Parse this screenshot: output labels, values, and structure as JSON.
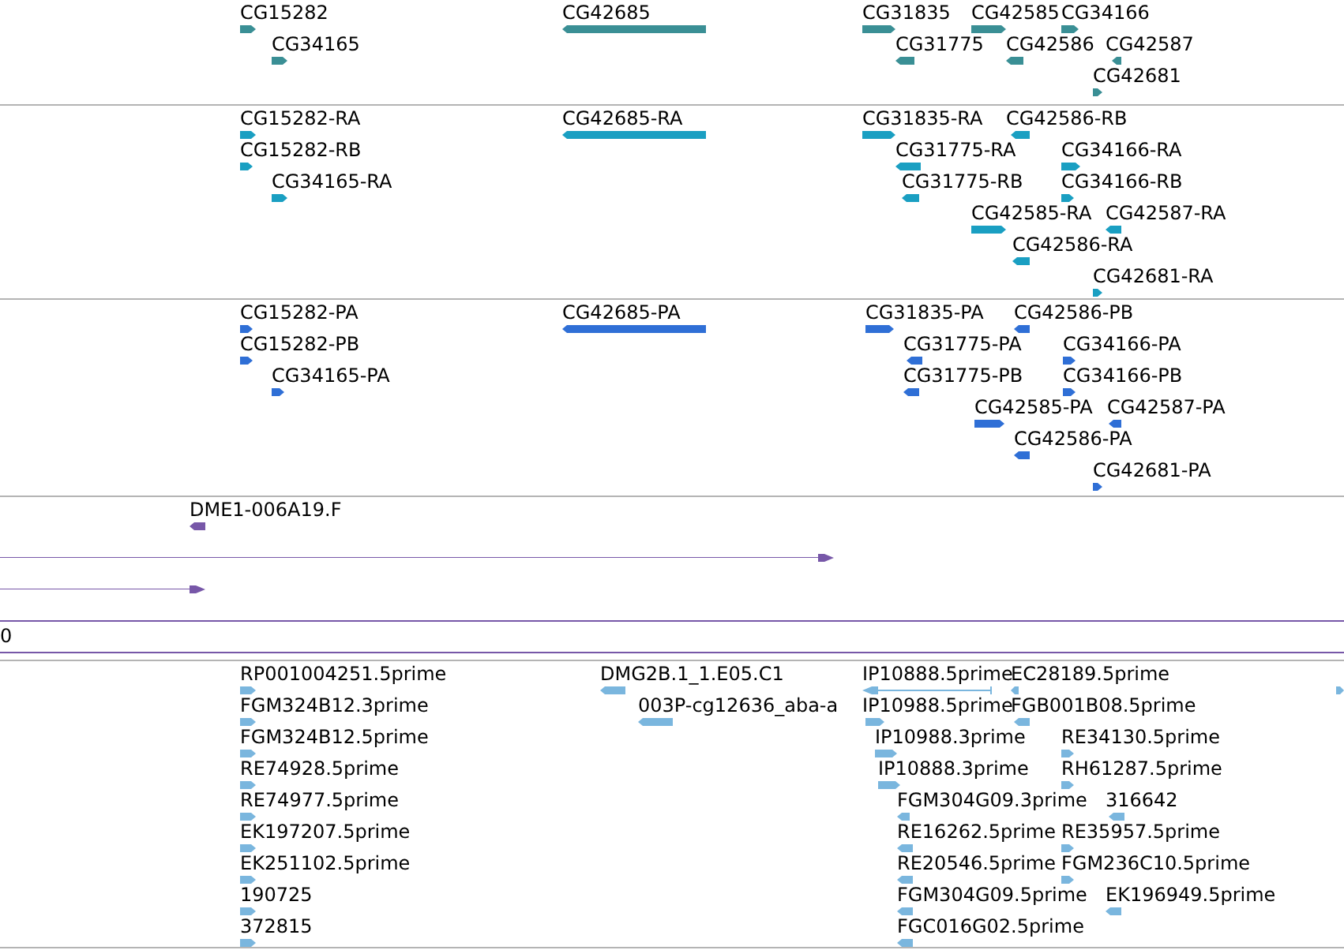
{
  "tracks": [
    {
      "color": "#3a8f95",
      "features": [
        {
          "label": "CG15282",
          "reverse": false,
          "kind": "block"
        },
        {
          "label": "CG34165",
          "reverse": false,
          "kind": "block"
        },
        {
          "label": "CG42685",
          "reverse": true,
          "kind": "block"
        },
        {
          "label": "CG31835",
          "reverse": false,
          "kind": "block"
        },
        {
          "label": "CG42585",
          "reverse": false,
          "kind": "block"
        },
        {
          "label": "CG34166",
          "reverse": false,
          "kind": "block"
        },
        {
          "label": "CG31775",
          "reverse": true,
          "kind": "block"
        },
        {
          "label": "CG42586",
          "reverse": true,
          "kind": "block"
        },
        {
          "label": "CG42587",
          "reverse": true,
          "kind": "block"
        },
        {
          "label": "CG42681",
          "reverse": false,
          "kind": "block"
        }
      ]
    },
    {
      "color": "#1a9fc2",
      "features": [
        {
          "label": "CG15282-RA",
          "reverse": false,
          "kind": "block"
        },
        {
          "label": "CG15282-RB",
          "reverse": false,
          "kind": "block"
        },
        {
          "label": "CG34165-RA",
          "reverse": false,
          "kind": "block"
        },
        {
          "label": "CG42685-RA",
          "reverse": true,
          "kind": "block"
        },
        {
          "label": "CG31835-RA",
          "reverse": false,
          "kind": "block"
        },
        {
          "label": "CG42586-RB",
          "reverse": true,
          "kind": "block"
        },
        {
          "label": "CG31775-RA",
          "reverse": true,
          "kind": "block"
        },
        {
          "label": "CG34166-RA",
          "reverse": false,
          "kind": "block"
        },
        {
          "label": "CG31775-RB",
          "reverse": true,
          "kind": "block"
        },
        {
          "label": "CG34166-RB",
          "reverse": false,
          "kind": "block"
        },
        {
          "label": "CG42585-RA",
          "reverse": false,
          "kind": "block"
        },
        {
          "label": "CG42587-RA",
          "reverse": true,
          "kind": "block"
        },
        {
          "label": "CG42586-RA",
          "reverse": true,
          "kind": "block"
        },
        {
          "label": "CG42681-RA",
          "reverse": false,
          "kind": "block"
        }
      ]
    },
    {
      "color": "#2f6fd6",
      "features": [
        {
          "label": "CG15282-PA",
          "reverse": false,
          "kind": "block"
        },
        {
          "label": "CG15282-PB",
          "reverse": false,
          "kind": "block"
        },
        {
          "label": "CG34165-PA",
          "reverse": false,
          "kind": "block"
        },
        {
          "label": "CG42685-PA",
          "reverse": true,
          "kind": "block"
        },
        {
          "label": "CG31835-PA",
          "reverse": false,
          "kind": "block"
        },
        {
          "label": "CG42586-PB",
          "reverse": true,
          "kind": "block"
        },
        {
          "label": "CG31775-PA",
          "reverse": true,
          "kind": "block"
        },
        {
          "label": "CG34166-PA",
          "reverse": false,
          "kind": "block"
        },
        {
          "label": "CG31775-PB",
          "reverse": true,
          "kind": "block"
        },
        {
          "label": "CG34166-PB",
          "reverse": false,
          "kind": "block"
        },
        {
          "label": "CG42585-PA",
          "reverse": false,
          "kind": "block"
        },
        {
          "label": "CG42587-PA",
          "reverse": true,
          "kind": "block"
        },
        {
          "label": "CG42586-PA",
          "reverse": true,
          "kind": "block"
        },
        {
          "label": "CG42681-PA",
          "reverse": false,
          "kind": "block"
        }
      ]
    },
    {
      "color": "#7757a8",
      "features": [
        {
          "label": "DME1-006A19.F",
          "reverse": true,
          "kind": "block"
        },
        {
          "reverse": false,
          "kind": "line"
        },
        {
          "reverse": false,
          "kind": "line"
        }
      ]
    },
    {
      "color": "#7ab6de",
      "features": [
        {
          "label": "RP001004251.5prime",
          "reverse": false,
          "kind": "block"
        },
        {
          "label": "FGM324B12.3prime",
          "reverse": false,
          "kind": "block"
        },
        {
          "label": "FGM324B12.5prime",
          "reverse": false,
          "kind": "block"
        },
        {
          "label": "RE74928.5prime",
          "reverse": false,
          "kind": "block"
        },
        {
          "label": "RE74977.5prime",
          "reverse": false,
          "kind": "block"
        },
        {
          "label": "EK197207.5prime",
          "reverse": false,
          "kind": "block"
        },
        {
          "label": "EK251102.5prime",
          "reverse": false,
          "kind": "block"
        },
        {
          "label": "190725",
          "reverse": false,
          "kind": "block"
        },
        {
          "label": "372815",
          "reverse": false,
          "kind": "block"
        },
        {
          "label": "DMG2B.1_1.E05.C1",
          "reverse": true,
          "kind": "block"
        },
        {
          "label": "003P-cg12636_aba-a",
          "reverse": true,
          "kind": "block"
        },
        {
          "label": "IP10888.5prime",
          "reverse": true,
          "kind": "line"
        },
        {
          "label": "EC28189.5prime",
          "reverse": true,
          "kind": "block"
        },
        {
          "label": "IP10988.5prime",
          "reverse": false,
          "kind": "block"
        },
        {
          "label": "FGB001B08.5prime",
          "reverse": true,
          "kind": "block"
        },
        {
          "label": "IP10988.3prime",
          "reverse": false,
          "kind": "block"
        },
        {
          "label": "RE34130.5prime",
          "reverse": false,
          "kind": "block"
        },
        {
          "label": "IP10888.3prime",
          "reverse": false,
          "kind": "block"
        },
        {
          "label": "RH61287.5prime",
          "reverse": false,
          "kind": "block"
        },
        {
          "label": "FGM304G09.3prime",
          "reverse": true,
          "kind": "block"
        },
        {
          "label": "316642",
          "reverse": true,
          "kind": "block"
        },
        {
          "label": "RE16262.5prime",
          "reverse": true,
          "kind": "block"
        },
        {
          "label": "RE35957.5prime",
          "reverse": false,
          "kind": "block"
        },
        {
          "label": "RE20546.5prime",
          "reverse": true,
          "kind": "block"
        },
        {
          "label": "FGM236C10.5prime",
          "reverse": false,
          "kind": "block"
        },
        {
          "label": "FGM304G09.5prime",
          "reverse": true,
          "kind": "block"
        },
        {
          "label": "EK196949.5prime",
          "reverse": true,
          "kind": "block"
        },
        {
          "label": "FGC016G02.5prime",
          "reverse": true,
          "kind": "block"
        },
        {
          "reverse": false,
          "kind": "block"
        }
      ]
    }
  ],
  "ruler": {
    "label": "0"
  }
}
